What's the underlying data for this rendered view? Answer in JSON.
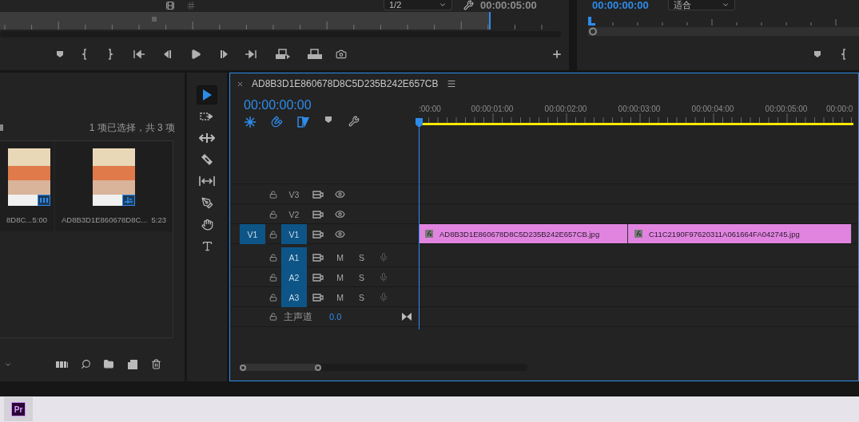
{
  "source_monitor": {
    "zoom_dropdown": "1/2",
    "duration": "00:00:05:00"
  },
  "program_monitor": {
    "timecode": "00:00:00:00",
    "zoom_dropdown": "适合"
  },
  "project_panel": {
    "selection_info": "1 项已选择，共 3 项",
    "items": [
      {
        "name": "8D8C...",
        "duration": "5:00",
        "kind": "video"
      },
      {
        "name": "AD8B3D1E860678D8C...",
        "duration": "5:23",
        "kind": "sequence"
      }
    ]
  },
  "tools": [
    {
      "kind": "selection",
      "selected": true
    },
    {
      "kind": "track-select",
      "selected": false
    },
    {
      "kind": "ripple",
      "selected": false
    },
    {
      "kind": "razor",
      "selected": false
    },
    {
      "kind": "slip",
      "selected": false
    },
    {
      "kind": "pen",
      "selected": false
    },
    {
      "kind": "hand",
      "selected": false
    },
    {
      "kind": "type",
      "selected": false
    }
  ],
  "timeline": {
    "title": "AD8B3D1E860678D8C5D235B242E657CB",
    "timecode": "00:00:00:00",
    "ruler_labels": [
      ":00:00",
      "00:00:01:00",
      "00:00:02:00",
      "00:00:03:00",
      "00:00:04:00",
      "00:00:05:00",
      "00:00:0"
    ],
    "tracks": [
      {
        "kind": "video",
        "name": "V3",
        "targeted": false
      },
      {
        "kind": "video",
        "name": "V2",
        "targeted": false
      },
      {
        "kind": "video",
        "name": "V1",
        "targeted": true,
        "source": "V1",
        "clips": [
          {
            "name": "AD8B3D1E860678D8C5D235B242E657CB.jpg"
          },
          {
            "name": "C11C2190F97620311A061664FA042745.jpg"
          }
        ]
      },
      {
        "kind": "audio",
        "name": "A1",
        "targeted": true,
        "mute": "M",
        "solo": "S"
      },
      {
        "kind": "audio",
        "name": "A2",
        "targeted": true,
        "mute": "M",
        "solo": "S"
      },
      {
        "kind": "audio",
        "name": "A3",
        "targeted": true,
        "mute": "M",
        "solo": "S"
      }
    ],
    "master": {
      "name": "主声道",
      "value": "0.0"
    }
  },
  "taskbar": {
    "app": "Pr"
  }
}
